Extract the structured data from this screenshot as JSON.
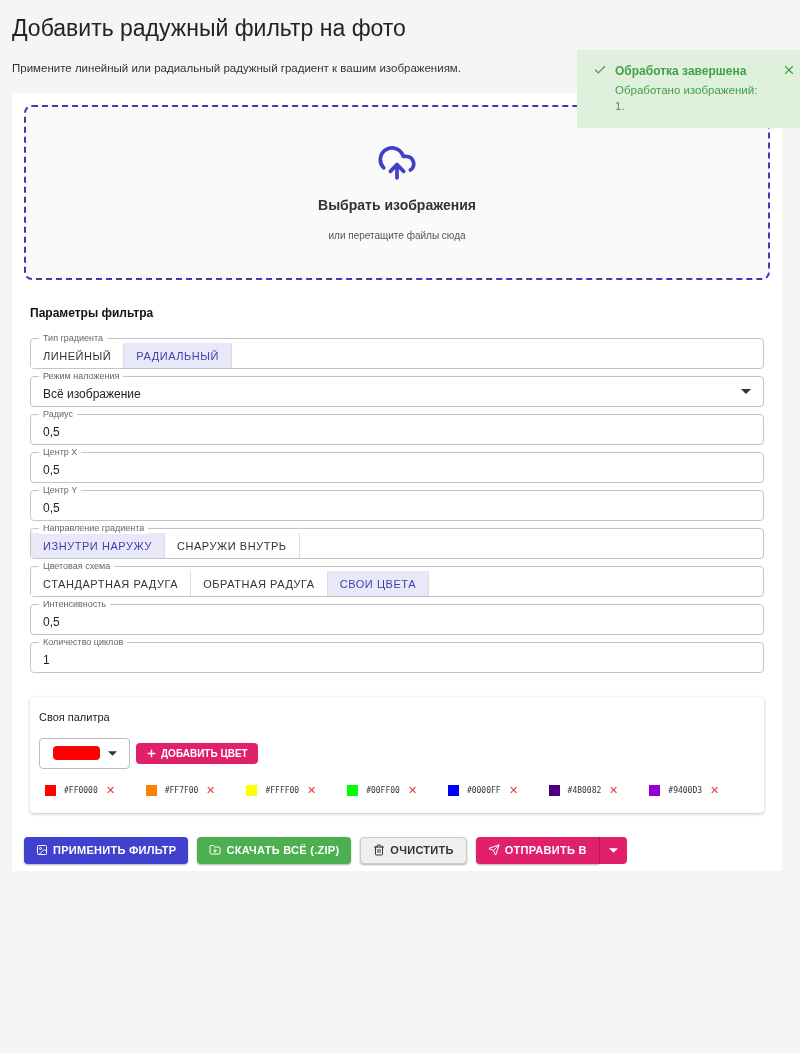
{
  "title": "Добавить радужный фильтр на фото",
  "subtitle": "Примените линейный или радиальный радужный градиент к вашим изображениям.",
  "toast": {
    "title": "Обработка завершена",
    "message": "Обработано изображений: 1."
  },
  "dropzone": {
    "title": "Выбрать изображения",
    "hint": "или перетащите файлы сюда"
  },
  "params": {
    "heading": "Параметры фильтра",
    "fields": [
      {
        "kind": "toggle",
        "label": "Тип градиента",
        "options": [
          {
            "label": "ЛИНЕЙНЫЙ",
            "selected": false
          },
          {
            "label": "РАДИАЛЬНЫЙ",
            "selected": true
          }
        ]
      },
      {
        "kind": "select",
        "label": "Режим наложения",
        "value": "Всё изображение"
      },
      {
        "kind": "text",
        "label": "Радиус",
        "value": "0,5"
      },
      {
        "kind": "text",
        "label": "Центр X",
        "value": "0,5"
      },
      {
        "kind": "text",
        "label": "Центр Y",
        "value": "0,5"
      },
      {
        "kind": "toggle",
        "label": "Направление градиента",
        "options": [
          {
            "label": "ИЗНУТРИ НАРУЖУ",
            "selected": true
          },
          {
            "label": "СНАРУЖИ ВНУТРЬ",
            "selected": false
          }
        ]
      },
      {
        "kind": "toggle",
        "label": "Цветовая схема",
        "options": [
          {
            "label": "СТАНДАРТНАЯ РАДУГА",
            "selected": false
          },
          {
            "label": "ОБРАТНАЯ РАДУГА",
            "selected": false
          },
          {
            "label": "СВОИ ЦВЕТА",
            "selected": true
          }
        ]
      },
      {
        "kind": "text",
        "label": "Интенсивность",
        "value": "0,5"
      },
      {
        "kind": "text",
        "label": "Количество циклов",
        "value": "1"
      }
    ]
  },
  "palette": {
    "heading": "Своя палитра",
    "picker": {
      "color": "#ff0000"
    },
    "add_button": "ДОБАВИТЬ ЦВЕТ",
    "remove_mark": "✕",
    "colors": [
      {
        "label": "#FF0000",
        "color": "#ff0000"
      },
      {
        "label": "#FF7F00",
        "color": "#ff7f00"
      },
      {
        "label": "#FFFF00",
        "color": "#ffff00"
      },
      {
        "label": "#00FF00",
        "color": "#00ff00"
      },
      {
        "label": "#0000FF",
        "color": "#0000ff"
      },
      {
        "label": "#4B0082",
        "color": "#4b0082"
      },
      {
        "label": "#9400D3",
        "color": "#9400d3"
      }
    ]
  },
  "actions": [
    {
      "kind": "apply",
      "label": "ПРИМЕНИТЬ ФИЛЬТР"
    },
    {
      "kind": "download",
      "label": "СКАЧАТЬ ВСЁ (.ZIP)"
    },
    {
      "kind": "clear",
      "label": "ОЧИСТИТЬ"
    },
    {
      "kind": "send",
      "label": "ОТПРАВИТЬ В"
    }
  ]
}
